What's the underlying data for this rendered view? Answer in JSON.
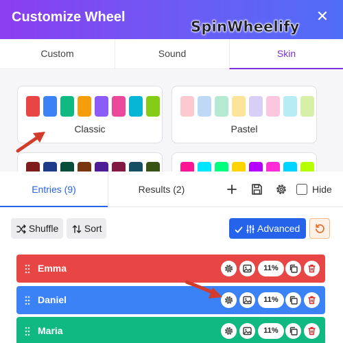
{
  "modal": {
    "title": "Customize Wheel",
    "brand": "SpinWheelify",
    "close_glyph": "✕",
    "tabs": [
      {
        "label": "Custom",
        "active": false
      },
      {
        "label": "Sound",
        "active": false
      },
      {
        "label": "Skin",
        "active": true
      }
    ],
    "skins": [
      {
        "name": "Classic",
        "colors": [
          "#e84545",
          "#3b82f6",
          "#10b981",
          "#f59e0b",
          "#8b5cf6",
          "#ec4899",
          "#06b6d4",
          "#84cc16"
        ]
      },
      {
        "name": "Pastel",
        "colors": [
          "#fbc9cf",
          "#bfd8f6",
          "#b4ead2",
          "#fce59a",
          "#d8cff6",
          "#fbc7df",
          "#b6ecf4",
          "#d6f0a8"
        ]
      },
      {
        "name": "",
        "colors": [
          "#7f1d1d",
          "#1e3a8a",
          "#064e3b",
          "#78350f",
          "#4c1d95",
          "#831843",
          "#164e63",
          "#365314"
        ]
      },
      {
        "name": "",
        "colors": [
          "#ff1493",
          "#00e5ff",
          "#00ff7f",
          "#ffd400",
          "#b400ff",
          "#ff2bd6",
          "#00d4ff",
          "#b6ff00"
        ]
      }
    ],
    "arrow_color": "#d23c2a"
  },
  "panel": {
    "tabs": [
      {
        "label": "Entries (9)",
        "active": true
      },
      {
        "label": "Results (2)",
        "active": false
      }
    ],
    "toolbar_icons": [
      "plus-icon",
      "save-icon",
      "gear-icon"
    ],
    "hide_label": "Hide",
    "hide_checked": false,
    "buttons": {
      "shuffle": "Shuffle",
      "sort": "Sort",
      "advanced": "Advanced",
      "reset_icon": "reset-icon"
    },
    "accent": "#2563eb",
    "entries": [
      {
        "name": "Emma",
        "percent": "11%",
        "color": "#e84545"
      },
      {
        "name": "Daniel",
        "percent": "11%",
        "color": "#3b82f6"
      },
      {
        "name": "Maria",
        "percent": "11%",
        "color": "#10b981"
      }
    ]
  }
}
